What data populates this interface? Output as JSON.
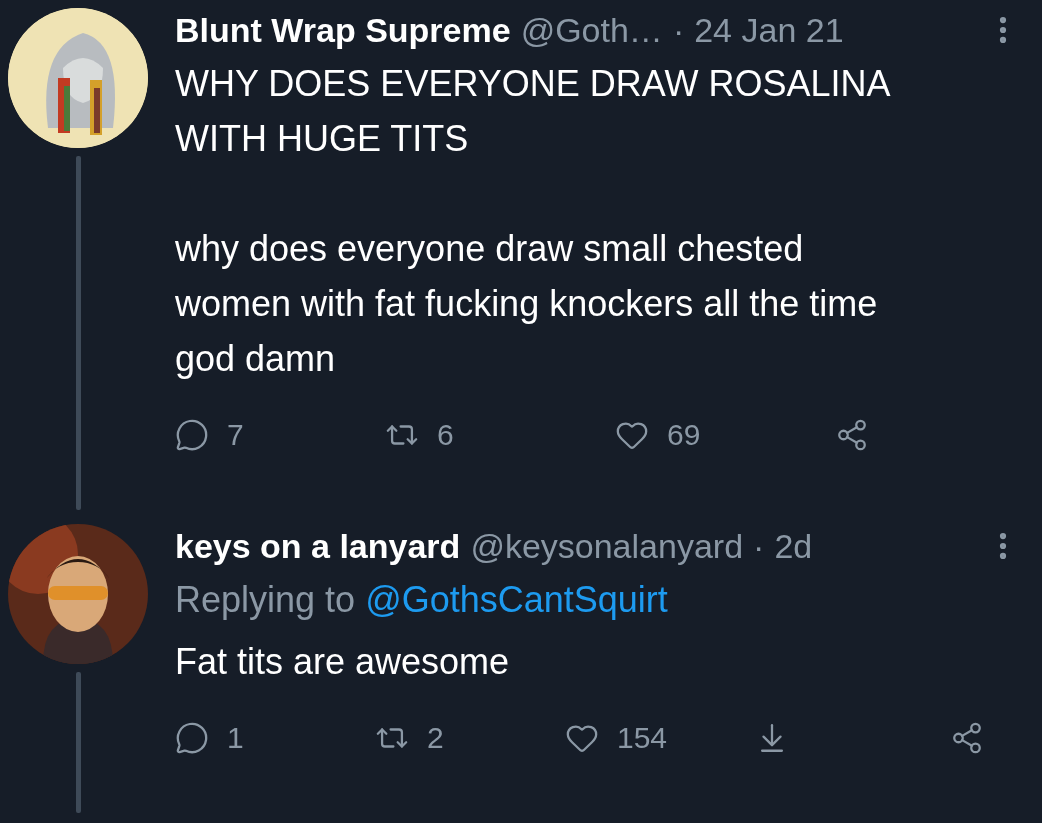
{
  "tweets": [
    {
      "author": "Blunt Wrap Supreme",
      "handle": "@Goth…",
      "separator": "·",
      "time": "24 Jan 21",
      "paragraphs": [
        "WHY DOES EVERYONE DRAW ROSALINA\nWITH HUGE TITS",
        "why does everyone draw small chested\nwomen with fat fucking knockers all the time\ngod damn"
      ],
      "actions": [
        {
          "kind": "reply",
          "count": "7"
        },
        {
          "kind": "retweet",
          "count": "6"
        },
        {
          "kind": "like",
          "count": "69"
        },
        {
          "kind": "share"
        }
      ]
    },
    {
      "author": "keys on a lanyard",
      "handle": "@keysonalanyard",
      "separator": "·",
      "time": "2d",
      "replying_to": {
        "label": "Replying to",
        "handle": "@GothsCantSquirt"
      },
      "paragraphs": [
        "Fat tits are awesome"
      ],
      "actions": [
        {
          "kind": "reply",
          "count": "1"
        },
        {
          "kind": "retweet",
          "count": "2"
        },
        {
          "kind": "like",
          "count": "154"
        },
        {
          "kind": "download"
        },
        {
          "kind": "share"
        }
      ]
    }
  ]
}
